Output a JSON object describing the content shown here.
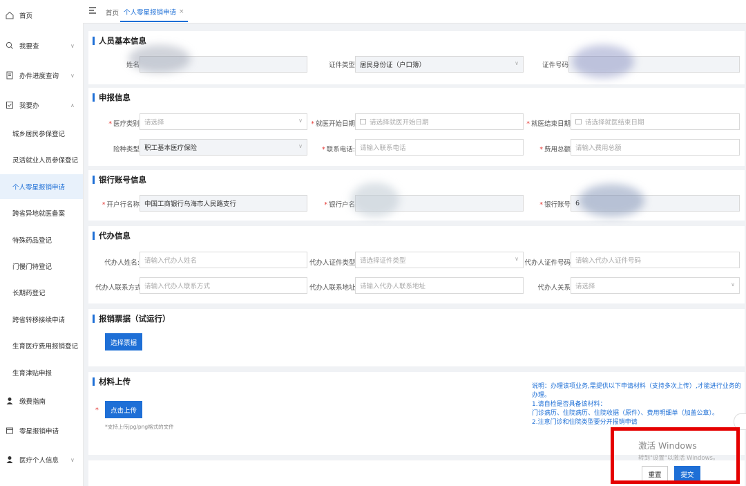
{
  "sidebar": {
    "home": "首页",
    "query": "我要查",
    "progress": "办件进度查询",
    "todo": "我要办",
    "sub_items": [
      "城乡居民参保登记",
      "灵活就业人员参保登记",
      "个人零星报销申请",
      "跨省异地就医备案",
      "特殊药品登记",
      "门慢门特登记",
      "长期药登记",
      "跨省转移接续申请",
      "生育医疗费用报销登记",
      "生育津贴申报"
    ],
    "guide": "缴费指南",
    "reimburse": "零星报销申请",
    "personal": "医疗个人信息"
  },
  "topbar": {
    "home": "首页",
    "active_tab": "个人零星报销申请",
    "close": "×"
  },
  "basic": {
    "title": "人员基本信息",
    "name_label": "姓名",
    "cert_type_label": "证件类型",
    "cert_type_value": "居民身份证（户口簿）",
    "cert_no_label": "证件号码"
  },
  "declare": {
    "title": "申报信息",
    "med_type_label": "医疗类别",
    "med_type_ph": "请选择",
    "start_label": "就医开始日期",
    "start_ph": "请选择就医开始日期",
    "end_label": "就医结束日期",
    "end_ph": "请选择就医结束日期",
    "ins_type_label": "险种类型",
    "ins_type_value": "职工基本医疗保险",
    "phone_label": "联系电话:",
    "phone_ph": "请输入联系电话",
    "total_label": "费用总额",
    "total_ph": "请输入费用总额"
  },
  "bank": {
    "title": "银行账号信息",
    "bank_name_label": "开户行名称",
    "bank_name_value": "中国工商银行乌海市人民路支行",
    "account_name_label": "银行户名",
    "account_no_label": "银行账号",
    "account_no_prefix": "6"
  },
  "agent": {
    "title": "代办信息",
    "name_label": "代办人姓名:",
    "name_ph": "请输入代办人姓名",
    "cert_type_label": "代办人证件类型",
    "cert_type_ph": "请选择证件类型",
    "cert_no_label": "代办人证件号码",
    "cert_no_ph": "请输入代办人证件号码",
    "contact_label": "代办人联系方式",
    "contact_ph": "请输入代办人联系方式",
    "address_label": "代办人联系地址",
    "address_ph": "请输入代办人联系地址",
    "relation_label": "代办人关系",
    "relation_ph": "请选择"
  },
  "invoice": {
    "title": "报销票据（试运行）",
    "button": "选择票据"
  },
  "upload": {
    "title": "材料上传",
    "button": "点击上传",
    "hint": "*支持上传jpg/png格式的文件",
    "notes": [
      "说明：办理该项业务,需提供以下申请材料（支持多次上传）,才能进行业务的办理。",
      "1.请自检是否具备该材料：",
      "门诊病历、住院病历、住院收据（原件）、费用明细单（加盖公章）。",
      "2.注意门诊和住院类型要分开报销申请"
    ]
  },
  "windows": {
    "activate": "激活 Windows",
    "hint": "转到\"设置\"以激活 Windows。"
  },
  "actions": {
    "reset": "重置",
    "submit": "提交"
  },
  "colors": {
    "primary": "#1e6fd6",
    "highlight_box": "#e50000"
  }
}
